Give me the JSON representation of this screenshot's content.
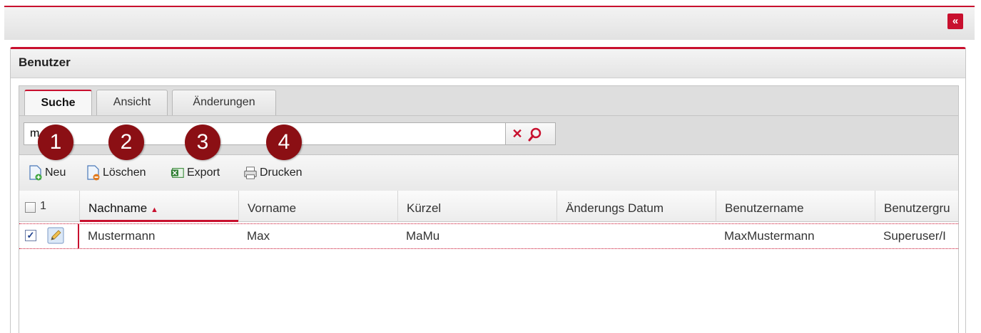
{
  "topbar": {
    "collapse_label": "«"
  },
  "panel": {
    "title": "Benutzer"
  },
  "tabs": [
    {
      "label": "Suche",
      "active": true
    },
    {
      "label": "Ansicht",
      "active": false
    },
    {
      "label": "Änderungen",
      "active": false
    }
  ],
  "search": {
    "value": "m",
    "clear_icon": "clear-icon",
    "search_icon": "magnifier-icon"
  },
  "toolbar": {
    "new_label": "Neu",
    "delete_label": "Löschen",
    "export_label": "Export",
    "print_label": "Drucken"
  },
  "callouts": [
    "1",
    "2",
    "3",
    "4"
  ],
  "grid": {
    "selected_count": "1",
    "columns": [
      "Nachname",
      "Vorname",
      "Kürzel",
      "Änderungs Datum",
      "Benutzername",
      "Benutzergru"
    ],
    "sort_column": "Nachname",
    "sort_direction": "ascending",
    "rows": [
      {
        "checked": true,
        "nachname": "Mustermann",
        "vorname": "Max",
        "kuerzel": "MaMu",
        "datum": "",
        "benutzername": "MaxMustermann",
        "gruppe": "Superuser/I"
      }
    ]
  },
  "colors": {
    "accent": "#c8102e",
    "callout": "#8b0f14"
  }
}
